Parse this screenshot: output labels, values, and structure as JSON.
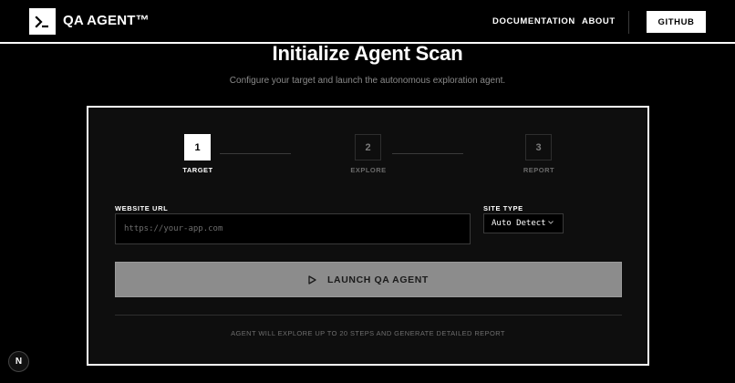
{
  "header": {
    "brand": "QA AGENT™",
    "logo_icon": "terminal-prompt-icon",
    "nav": {
      "documentation": "DOCUMENTATION",
      "about": "ABOUT",
      "github": "GITHUB"
    }
  },
  "main": {
    "title": "Initialize Agent Scan",
    "subtitle": "Configure your target and launch the autonomous exploration agent."
  },
  "steps": [
    {
      "number": "1",
      "label": "TARGET",
      "active": true
    },
    {
      "number": "2",
      "label": "EXPLORE",
      "active": false
    },
    {
      "number": "3",
      "label": "REPORT",
      "active": false
    }
  ],
  "form": {
    "url_label": "WEBSITE URL",
    "url_placeholder": "https://your-app.com",
    "url_value": "",
    "site_type_label": "SITE TYPE",
    "site_type_value": "Auto Detect",
    "launch_label": "LAUNCH QA AGENT",
    "footnote": "AGENT WILL EXPLORE UP TO 20 STEPS AND GENERATE DETAILED REPORT"
  },
  "badge": {
    "letter": "N"
  },
  "colors": {
    "background": "#000000",
    "card": "#0e0e0e",
    "accent": "#ffffff",
    "button": "#8c8c8c",
    "muted_text": "#8a8a8a"
  }
}
